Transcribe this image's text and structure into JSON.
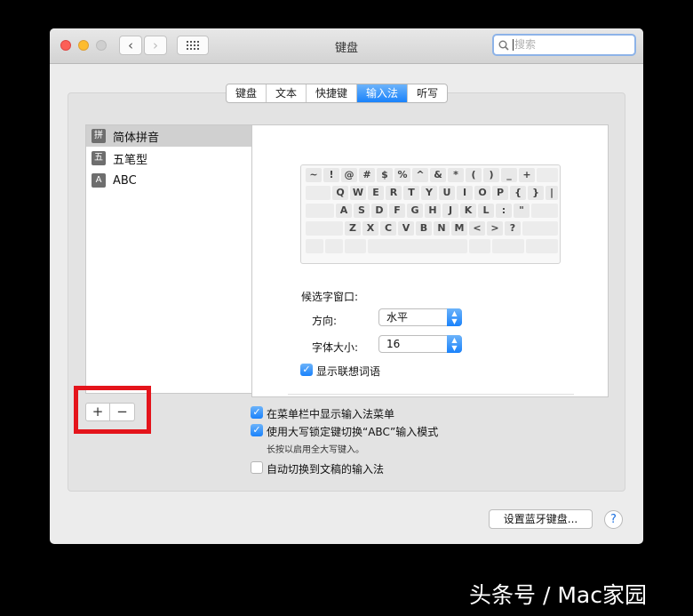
{
  "window": {
    "title": "键盘"
  },
  "search": {
    "placeholder": "搜索"
  },
  "tabs": [
    "键盘",
    "文本",
    "快捷键",
    "输入法",
    "听写"
  ],
  "input_sources": [
    {
      "icon": "拼",
      "label": "简体拼音",
      "selected": true
    },
    {
      "icon": "五",
      "label": "五笔型",
      "selected": false
    },
    {
      "icon": "A",
      "label": "ABC",
      "selected": false
    }
  ],
  "keyboard": {
    "rows": [
      [
        "~",
        "!",
        "@",
        "#",
        "$",
        "%",
        "^",
        "&",
        "*",
        "(",
        ")",
        "_",
        "+",
        ""
      ],
      [
        "",
        "Q",
        "W",
        "E",
        "R",
        "T",
        "Y",
        "U",
        "I",
        "O",
        "P",
        "{",
        "}",
        "|"
      ],
      [
        "",
        "A",
        "S",
        "D",
        "F",
        "G",
        "H",
        "J",
        "K",
        "L",
        ":",
        "\"",
        ""
      ],
      [
        "",
        "Z",
        "X",
        "C",
        "V",
        "B",
        "N",
        "M",
        "<",
        ">",
        "?",
        ""
      ],
      [
        "",
        "",
        "",
        "",
        "",
        "",
        ""
      ]
    ]
  },
  "candidate": {
    "title": "候选字窗口:",
    "direction_label": "方向:",
    "direction_value": "水平",
    "font_size_label": "字体大小:",
    "font_size_value": "16",
    "show_associated": "显示联想词语",
    "show_associated_checked": true
  },
  "list_buttons": {
    "add": "+",
    "remove": "−"
  },
  "options": {
    "show_menu": "在菜单栏中显示输入法菜单",
    "show_menu_checked": true,
    "caps_switch": "使用大写锁定键切换“ABC”输入模式",
    "caps_switch_checked": true,
    "caps_hint": "长按以启用全大写键入。",
    "auto_switch": "自动切换到文稿的输入法",
    "auto_switch_checked": false
  },
  "bottom": {
    "bluetooth_button": "设置蓝牙键盘...",
    "help": "?"
  },
  "watermark": "头条号 / Mac家园",
  "colors": {
    "accent": "#1a82fb",
    "highlight": "#e4141b"
  }
}
